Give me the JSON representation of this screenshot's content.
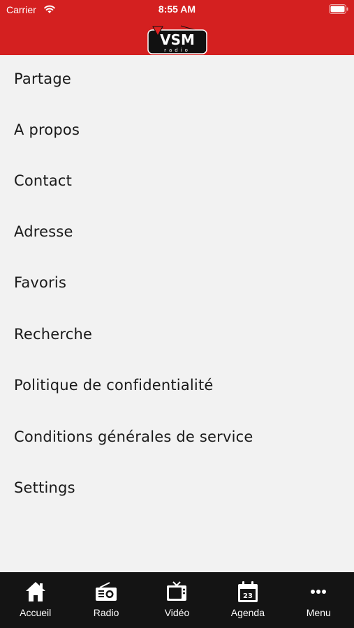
{
  "status_bar": {
    "carrier": "Carrier",
    "time": "8:55 AM"
  },
  "header": {
    "logo_text": "VSM",
    "logo_subtext": "radio",
    "background_color": "#d42020"
  },
  "menu": {
    "items": [
      {
        "label": "Partage"
      },
      {
        "label": "A propos"
      },
      {
        "label": "Contact"
      },
      {
        "label": "Adresse"
      },
      {
        "label": "Favoris"
      },
      {
        "label": "Recherche"
      },
      {
        "label": "Politique de confidentialité"
      },
      {
        "label": "Conditions générales de service"
      },
      {
        "label": "Settings"
      }
    ]
  },
  "tab_bar": {
    "tabs": [
      {
        "label": "Accueil",
        "icon": "home-icon"
      },
      {
        "label": "Radio",
        "icon": "radio-icon"
      },
      {
        "label": "Vidéo",
        "icon": "tv-icon"
      },
      {
        "label": "Agenda",
        "icon": "calendar-icon",
        "badge": "23"
      },
      {
        "label": "Menu",
        "icon": "more-icon"
      }
    ]
  }
}
